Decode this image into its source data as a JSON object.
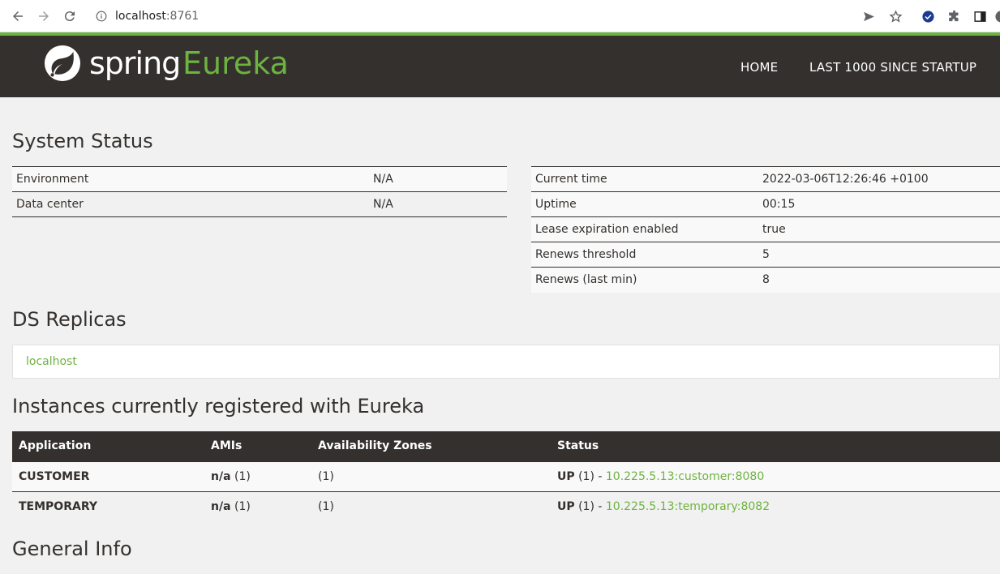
{
  "browser": {
    "url_host": "localhost",
    "url_port": ":8761"
  },
  "header": {
    "logo_spring": "spring",
    "logo_eureka": "Eureka",
    "nav": [
      "HOME",
      "LAST 1000 SINCE STARTUP"
    ]
  },
  "system_status": {
    "title": "System Status",
    "left": [
      {
        "label": "Environment",
        "value": "N/A"
      },
      {
        "label": "Data center",
        "value": "N/A"
      }
    ],
    "right": [
      {
        "label": "Current time",
        "value": "2022-03-06T12:26:46 +0100"
      },
      {
        "label": "Uptime",
        "value": "00:15"
      },
      {
        "label": "Lease expiration enabled",
        "value": "true"
      },
      {
        "label": "Renews threshold",
        "value": "5"
      },
      {
        "label": "Renews (last min)",
        "value": "8"
      }
    ]
  },
  "ds_replicas": {
    "title": "DS Replicas",
    "items": [
      "localhost"
    ]
  },
  "instances": {
    "title": "Instances currently registered with Eureka",
    "columns": [
      "Application",
      "AMIs",
      "Availability Zones",
      "Status"
    ],
    "rows": [
      {
        "application": "CUSTOMER",
        "ami_bold": "n/a",
        "ami_count": " (1)",
        "zones": "(1)",
        "status_bold": "UP",
        "status_count": " (1) - ",
        "instance": "10.225.5.13:customer:8080"
      },
      {
        "application": "TEMPORARY",
        "ami_bold": "n/a",
        "ami_count": " (1)",
        "zones": "(1)",
        "status_bold": "UP",
        "status_count": " (1) - ",
        "instance": "10.225.5.13:temporary:8082"
      }
    ]
  },
  "general_info": {
    "title": "General Info"
  },
  "colors": {
    "brand_green": "#6db33f",
    "header_dark": "#34302d"
  }
}
